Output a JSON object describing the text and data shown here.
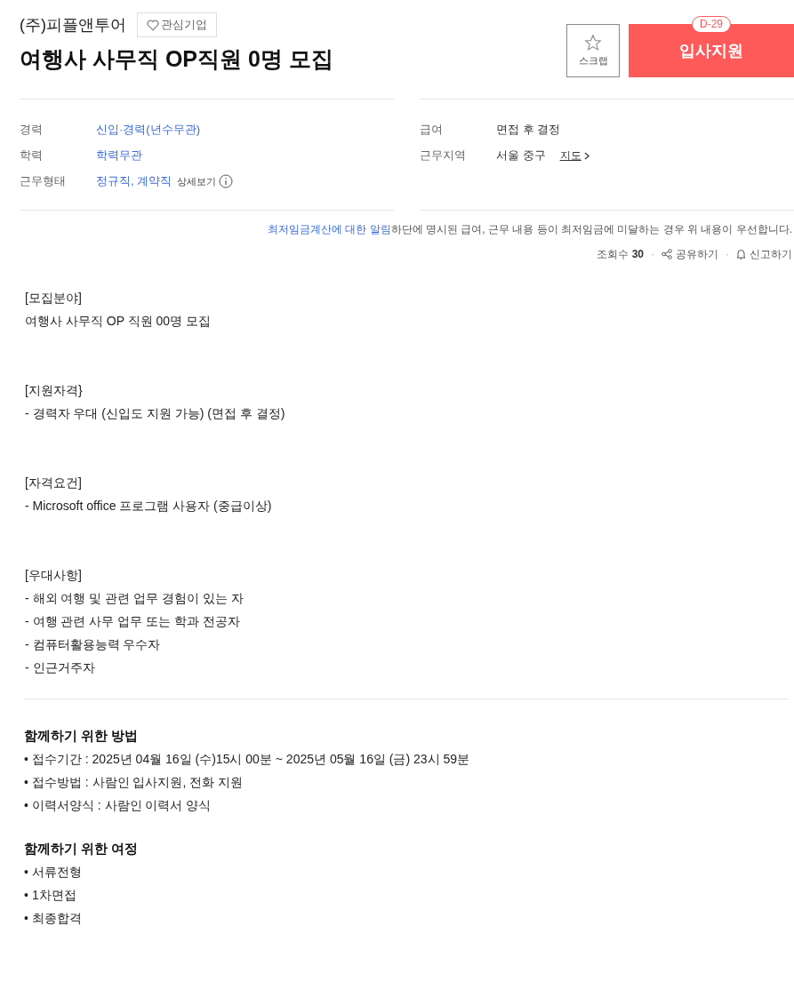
{
  "company": "(주)피플앤투어",
  "follow_button": {
    "label": "관심기업",
    "on": false
  },
  "title": "여행사 사무직 OP직원 0명 모집",
  "scrap_button": {
    "label": "스크랩",
    "on": false
  },
  "apply_button": {
    "label": "입사지원",
    "badge": "D-29"
  },
  "summary_left": [
    {
      "label": "경력",
      "value": "신입·경력(년수무관)",
      "kind": "link"
    },
    {
      "label": "학력",
      "value": "학력무관",
      "kind": "link"
    },
    {
      "label": "근무형태",
      "value": "정규직, 계약직",
      "kind": "detail",
      "extra": "상세보기"
    }
  ],
  "summary_right": [
    {
      "label": "급여",
      "value": "면접 후 결정",
      "kind": "plain"
    },
    {
      "label": "근무지역",
      "value": "서울 중구",
      "kind": "map",
      "extra": "지도"
    }
  ],
  "notice": {
    "link": "최저임금계산에 대한 알림",
    "text": "하단에 명시된 급여, 근무 내용 등이 최저임금에 미달하는 경우 위 내용이 우선합니다."
  },
  "stats": {
    "views_label": "조회수",
    "views": "30",
    "separator": "·",
    "share": "공유하기",
    "report": "신고하기"
  },
  "body": [
    {
      "lines": [
        "[모집분야]",
        "여행사 사무직 OP 직원 00명 모집"
      ]
    },
    {
      "lines": [
        "[지원자격}",
        "- 경력자 우대 (신입도 지원 가능) (면접 후 결정)"
      ]
    },
    {
      "lines": [
        "[자격요건]",
        "- Microsoft office 프로그램 사용자 (중급이상)"
      ]
    },
    {
      "lines": [
        "[우대사항]",
        "- 해외 여행 및 관련 업무 경험이 있는 자",
        "- 여행 관련 사무 업무 또는 학과 전공자",
        "- 컴퓨터활용능력 우수자",
        "- 인근거주자"
      ]
    }
  ],
  "sections": [
    {
      "heading": "함께하기 위한 방법",
      "items": [
        "접수기간 : 2025년 04월 16일 (수)15시 00분 ~ 2025년 05월 16일 (금) 23시 59분",
        "접수방법 : 사람인 입사지원, 전화 지원",
        "이력서양식 : 사람인 이력서 양식"
      ]
    },
    {
      "heading": "함께하기 위한 여정",
      "items": [
        "서류전형",
        "1차면접",
        "최종합격"
      ]
    }
  ],
  "bullet": "•"
}
